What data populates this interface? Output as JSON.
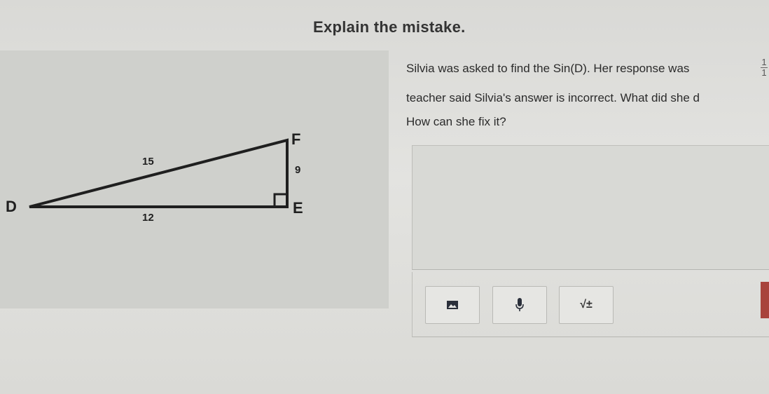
{
  "header": {
    "title": "Explain the mistake."
  },
  "question": {
    "line1": "Silvia was asked to find the Sin(D).  Her response was",
    "fraction_top": "1",
    "fraction_bottom": "1",
    "line2": "teacher said Silvia's answer is incorrect.  What did she d",
    "line3": "How can she fix it?"
  },
  "triangle": {
    "vertex_d": "D",
    "vertex_e": "E",
    "vertex_f": "F",
    "side_hypotenuse": "15",
    "side_vertical": "9",
    "side_base": "12"
  },
  "answer": {
    "value": ""
  },
  "toolbar": {
    "image_icon": "image-icon",
    "mic_icon": "microphone-icon",
    "math_label": "√±"
  },
  "colors": {
    "accent": "#a8433c"
  }
}
